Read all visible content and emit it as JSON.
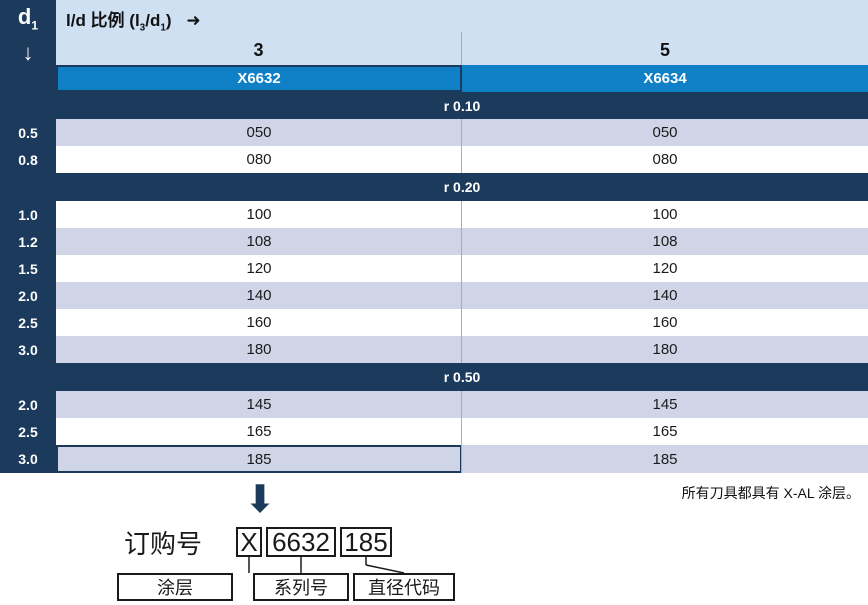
{
  "header": {
    "d1_label": "d",
    "d1_sub": "1",
    "d1_arrow": "↓",
    "ratio_prefix": "l/d 比例 (l",
    "ratio_sub1": "3",
    "ratio_mid": "/d",
    "ratio_sub2": "1",
    "ratio_suffix": ")",
    "ratio_arrow": "➜",
    "col1_title": "3",
    "col2_title": "5",
    "col1_code": "X6632",
    "col2_code": "X6634"
  },
  "bands": [
    "r 0.10",
    "r 0.20",
    "r 0.50"
  ],
  "rows": [
    {
      "d": "0.5",
      "c1": "050",
      "c2": "050"
    },
    {
      "d": "0.8",
      "c1": "080",
      "c2": "080"
    },
    {
      "d": "1.0",
      "c1": "100",
      "c2": "100"
    },
    {
      "d": "1.2",
      "c1": "108",
      "c2": "108"
    },
    {
      "d": "1.5",
      "c1": "120",
      "c2": "120"
    },
    {
      "d": "2.0",
      "c1": "140",
      "c2": "140"
    },
    {
      "d": "2.5",
      "c1": "160",
      "c2": "160"
    },
    {
      "d": "3.0",
      "c1": "180",
      "c2": "180"
    },
    {
      "d": "2.0",
      "c1": "145",
      "c2": "145"
    },
    {
      "d": "2.5",
      "c1": "165",
      "c2": "165"
    },
    {
      "d": "3.0",
      "c1": "185",
      "c2": "185"
    }
  ],
  "note": "所有刀具都具有 X-AL 涂层。",
  "order": {
    "label": "订购号",
    "down_arrow": "⬇",
    "part1": "X",
    "part2": "6632",
    "part3": "185",
    "desc1": "涂层",
    "desc2": "系列号",
    "desc3": "直径代码"
  },
  "colors": {
    "dark_navy": "#1b3a5c",
    "header_light_blue": "#cfe0f3",
    "code_blue": "#0f7fc6",
    "row_alt": "#cfd5e6",
    "row_white": "#ffffff"
  }
}
